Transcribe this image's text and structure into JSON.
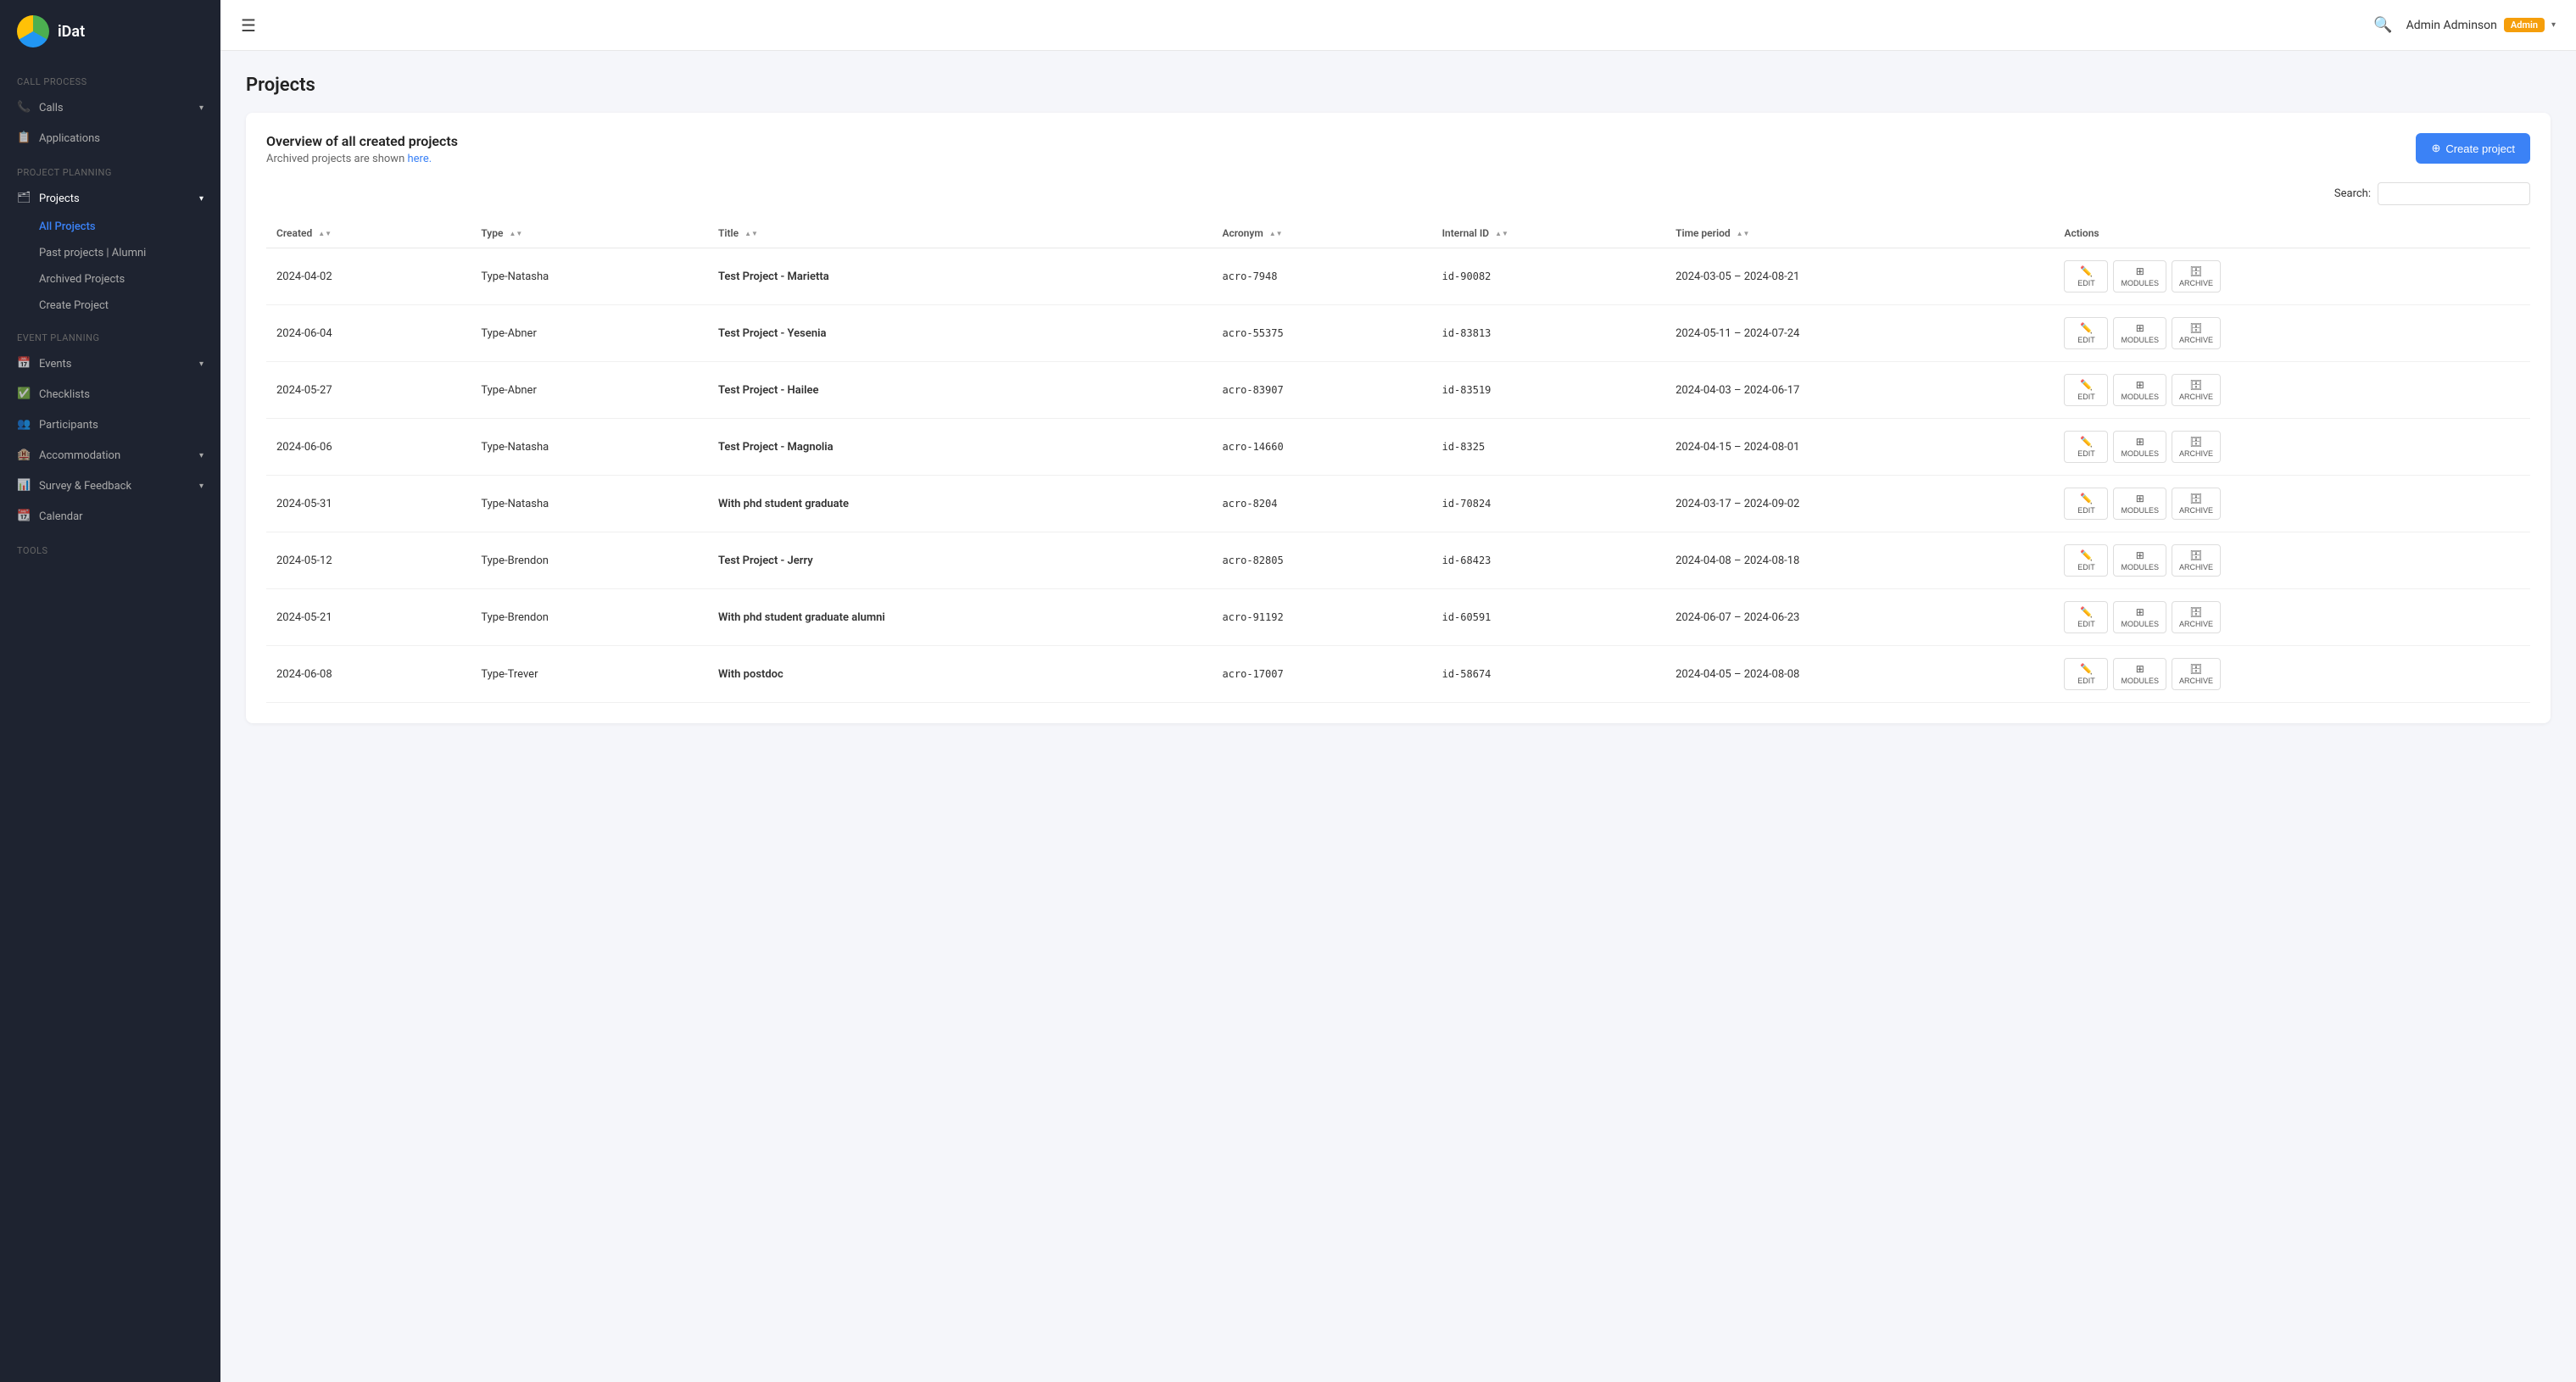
{
  "app": {
    "name": "iDat"
  },
  "header": {
    "user_name": "Admin Adminson",
    "admin_badge": "Admin",
    "menu_icon": "☰",
    "search_icon": "🔍",
    "chevron": "▾"
  },
  "sidebar": {
    "sections": [
      {
        "label": "Call Process",
        "items": [
          {
            "id": "calls",
            "label": "Calls",
            "icon": "📞",
            "has_chevron": true
          },
          {
            "id": "applications",
            "label": "Applications",
            "icon": "📋",
            "has_chevron": false
          }
        ]
      },
      {
        "label": "Project Planning",
        "items": [
          {
            "id": "projects",
            "label": "Projects",
            "icon": "🗂",
            "has_chevron": true,
            "active": true,
            "subitems": [
              {
                "id": "all-projects",
                "label": "All Projects",
                "active": true
              },
              {
                "id": "past-projects",
                "label": "Past projects | Alumni",
                "active": false
              },
              {
                "id": "archived-projects",
                "label": "Archived Projects",
                "active": false
              },
              {
                "id": "create-project",
                "label": "Create Project",
                "active": false
              }
            ]
          }
        ]
      },
      {
        "label": "Event Planning",
        "items": [
          {
            "id": "events",
            "label": "Events",
            "icon": "📅",
            "has_chevron": true
          },
          {
            "id": "checklists",
            "label": "Checklists",
            "icon": "✅",
            "has_chevron": false
          },
          {
            "id": "participants",
            "label": "Participants",
            "icon": "👥",
            "has_chevron": false
          },
          {
            "id": "accommodation",
            "label": "Accommodation",
            "icon": "🏨",
            "has_chevron": true
          },
          {
            "id": "survey-feedback",
            "label": "Survey & Feedback",
            "icon": "📊",
            "has_chevron": true
          },
          {
            "id": "calendar",
            "label": "Calendar",
            "icon": "📆",
            "has_chevron": false
          }
        ]
      },
      {
        "label": "Tools",
        "items": []
      }
    ]
  },
  "page": {
    "title": "Projects",
    "card": {
      "heading": "Overview of all created projects",
      "sub_text": "Archived projects are shown",
      "archive_link": "here.",
      "create_btn_label": "Create project",
      "search_label": "Search:"
    },
    "table": {
      "columns": [
        {
          "key": "created",
          "label": "Created"
        },
        {
          "key": "type",
          "label": "Type"
        },
        {
          "key": "title",
          "label": "Title"
        },
        {
          "key": "acronym",
          "label": "Acronym"
        },
        {
          "key": "internal_id",
          "label": "Internal ID"
        },
        {
          "key": "time_period",
          "label": "Time period"
        },
        {
          "key": "actions",
          "label": "Actions"
        }
      ],
      "rows": [
        {
          "created": "2024-04-02",
          "type": "Type-Natasha",
          "title": "Test Project - Marietta",
          "acronym": "acro-7948",
          "internal_id": "id-90082",
          "time_period": "2024-03-05 – 2024-08-21"
        },
        {
          "created": "2024-06-04",
          "type": "Type-Abner",
          "title": "Test Project - Yesenia",
          "acronym": "acro-55375",
          "internal_id": "id-83813",
          "time_period": "2024-05-11 – 2024-07-24"
        },
        {
          "created": "2024-05-27",
          "type": "Type-Abner",
          "title": "Test Project - Hailee",
          "acronym": "acro-83907",
          "internal_id": "id-83519",
          "time_period": "2024-04-03 – 2024-06-17"
        },
        {
          "created": "2024-06-06",
          "type": "Type-Natasha",
          "title": "Test Project - Magnolia",
          "acronym": "acro-14660",
          "internal_id": "id-8325",
          "time_period": "2024-04-15 – 2024-08-01"
        },
        {
          "created": "2024-05-31",
          "type": "Type-Natasha",
          "title": "With phd student graduate",
          "acronym": "acro-8204",
          "internal_id": "id-70824",
          "time_period": "2024-03-17 – 2024-09-02"
        },
        {
          "created": "2024-05-12",
          "type": "Type-Brendon",
          "title": "Test Project - Jerry",
          "acronym": "acro-82805",
          "internal_id": "id-68423",
          "time_period": "2024-04-08 – 2024-08-18"
        },
        {
          "created": "2024-05-21",
          "type": "Type-Brendon",
          "title": "With phd student graduate alumni",
          "acronym": "acro-91192",
          "internal_id": "id-60591",
          "time_period": "2024-06-07 – 2024-06-23"
        },
        {
          "created": "2024-06-08",
          "type": "Type-Trever",
          "title": "With postdoc",
          "acronym": "acro-17007",
          "internal_id": "id-58674",
          "time_period": "2024-04-05 – 2024-08-08"
        }
      ],
      "action_btns": [
        {
          "key": "edit",
          "label": "EDIT",
          "icon": "✏️"
        },
        {
          "key": "modules",
          "label": "MODULES",
          "icon": "⊞"
        },
        {
          "key": "archive",
          "label": "ARCHIVE",
          "icon": "🗄"
        }
      ]
    }
  }
}
